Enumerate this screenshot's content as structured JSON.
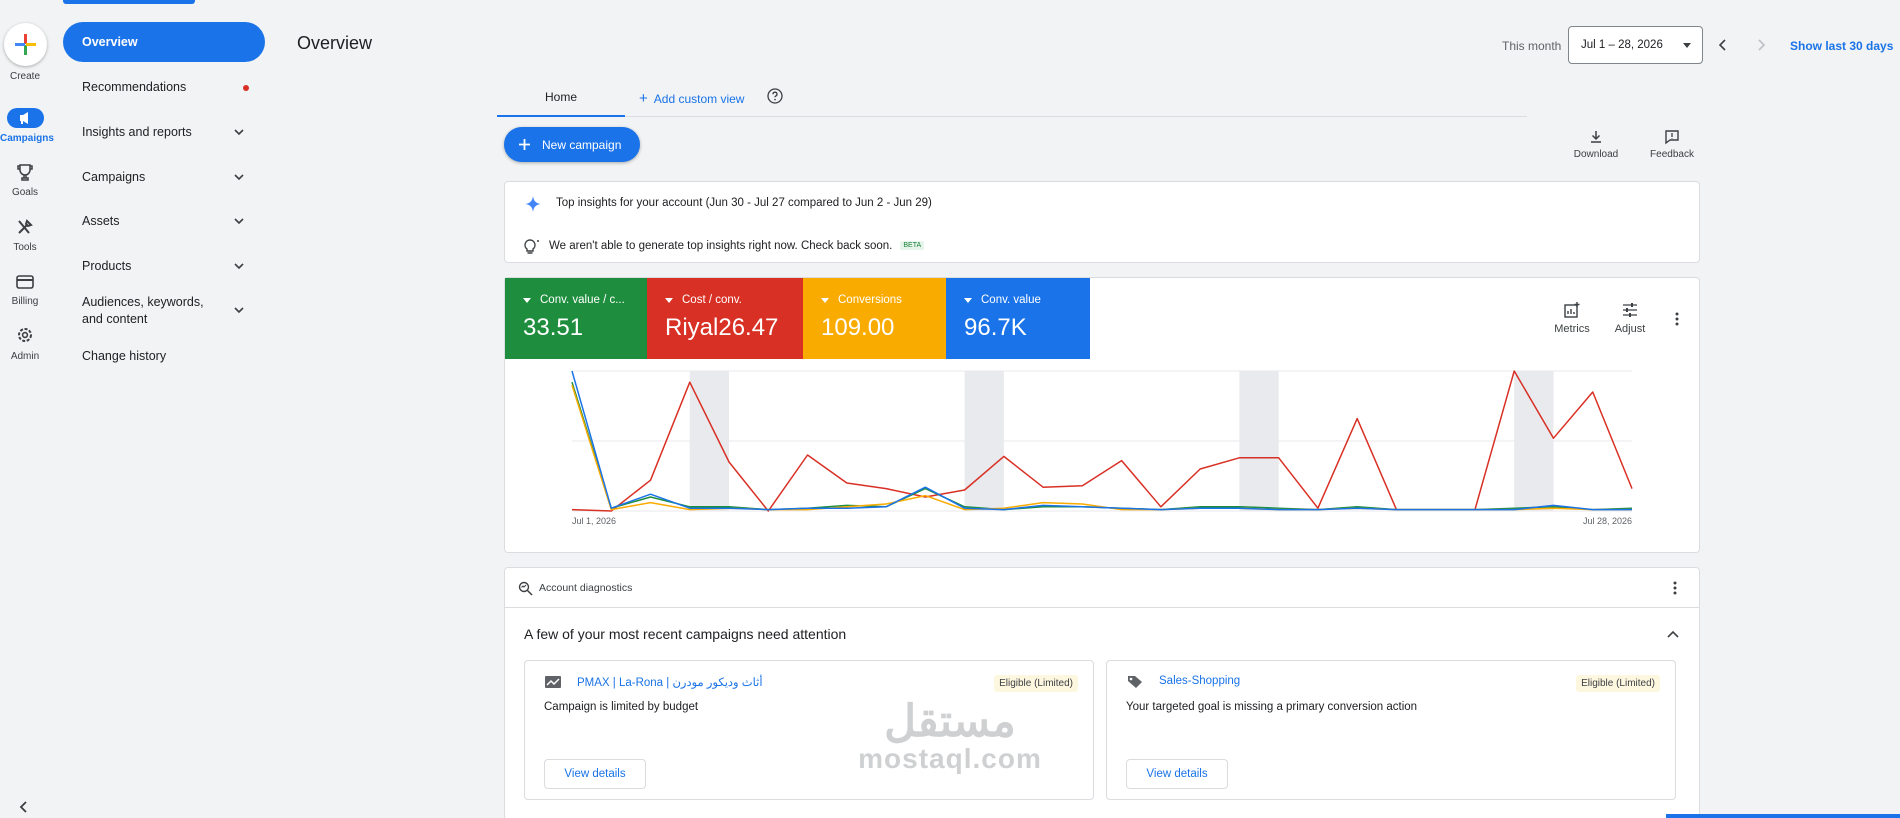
{
  "rail": {
    "create_label": "Create",
    "items": [
      {
        "label": "Campaigns",
        "icon": "megaphone-icon",
        "active": true
      },
      {
        "label": "Goals",
        "icon": "trophy-icon"
      },
      {
        "label": "Tools",
        "icon": "tools-icon"
      },
      {
        "label": "Billing",
        "icon": "credit-card-icon"
      },
      {
        "label": "Admin",
        "icon": "gear-icon"
      }
    ]
  },
  "sidenav": {
    "items": [
      {
        "label": "Overview",
        "active": true
      },
      {
        "label": "Recommendations",
        "dot": true
      },
      {
        "label": "Insights and reports",
        "expandable": true
      },
      {
        "label": "Campaigns",
        "expandable": true
      },
      {
        "label": "Assets",
        "expandable": true
      },
      {
        "label": "Products",
        "expandable": true
      },
      {
        "label": "Audiences, keywords, and content",
        "expandable": true
      },
      {
        "label": "Change history"
      }
    ]
  },
  "header": {
    "title": "Overview",
    "range_label": "This month",
    "date_value": "Jul 1 – 28, 2026",
    "show_last": "Show last 30 days"
  },
  "tabs": {
    "home": "Home",
    "add_custom": "Add custom view"
  },
  "toolbar": {
    "new_campaign": "New campaign",
    "download": "Download",
    "feedback": "Feedback"
  },
  "insights": {
    "heading": "Top insights for your account (Jun 30 - Jul 27 compared to Jun 2 - Jun 29)",
    "message": "We aren't able to generate top insights right now. Check back soon.",
    "badge": "BETA"
  },
  "metrics": [
    {
      "label": "Conv. value / c...",
      "value": "33.51",
      "color": "#1e8e3e"
    },
    {
      "label": "Cost / conv.",
      "value": "Riyal26.47",
      "color": "#d93025"
    },
    {
      "label": "Conversions",
      "value": "109.00",
      "color": "#f9ab00"
    },
    {
      "label": "Conv. value",
      "value": "96.7K",
      "color": "#1a73e8"
    }
  ],
  "chart_actions": {
    "metrics": "Metrics",
    "adjust": "Adjust"
  },
  "chart_data": {
    "type": "line",
    "x_start": "Jul 1, 2026",
    "x_end": "Jul 28, 2026",
    "x": [
      1,
      2,
      3,
      4,
      5,
      6,
      7,
      8,
      9,
      10,
      11,
      12,
      13,
      14,
      15,
      16,
      17,
      18,
      19,
      20,
      21,
      22,
      23,
      24,
      25,
      26,
      27,
      28
    ],
    "weekend_bands": [
      [
        4,
        5
      ],
      [
        11,
        12
      ],
      [
        18,
        19
      ],
      [
        25,
        26
      ]
    ],
    "grid": true,
    "y_scale": "normalized",
    "series": [
      {
        "name": "Cost / conv.",
        "color": "#d93025",
        "values": [
          1,
          0,
          22,
          92,
          35,
          0,
          40,
          20,
          16,
          10,
          15,
          39,
          17,
          18,
          36,
          3,
          30,
          38,
          38,
          2,
          66,
          1,
          1,
          1,
          100,
          52,
          85,
          16
        ]
      },
      {
        "name": "Conv. value / c...",
        "color": "#1e8e3e",
        "values": [
          92,
          2,
          10,
          3,
          3,
          1,
          2,
          4,
          3,
          16,
          3,
          1,
          3,
          3,
          2,
          1,
          3,
          3,
          2,
          1,
          3,
          1,
          1,
          1,
          2,
          3,
          1,
          2
        ]
      },
      {
        "name": "Conversions",
        "color": "#f9ab00",
        "values": [
          90,
          1,
          6,
          1,
          2,
          1,
          1,
          3,
          5,
          11,
          1,
          2,
          6,
          5,
          1,
          1,
          2,
          2,
          1,
          1,
          2,
          1,
          1,
          1,
          1,
          2,
          1,
          1
        ]
      },
      {
        "name": "Conv. value",
        "color": "#1a73e8",
        "values": [
          100,
          2,
          12,
          2,
          2,
          1,
          2,
          2,
          3,
          17,
          2,
          1,
          4,
          3,
          2,
          1,
          2,
          2,
          1,
          1,
          2,
          1,
          1,
          1,
          1,
          4,
          1,
          1
        ]
      }
    ]
  },
  "diagnostics": {
    "title": "Account diagnostics",
    "attention": "A few of your most recent campaigns need attention",
    "campaigns": [
      {
        "name": "PMAX | La-Rona | أثاث وديكور مودرن",
        "badge": "Eligible (Limited)",
        "message": "Campaign is limited by budget",
        "button": "View details"
      },
      {
        "name": "Sales-Shopping",
        "badge": "Eligible (Limited)",
        "message": "Your targeted goal is missing a primary conversion action",
        "button": "View details"
      }
    ]
  },
  "watermark": {
    "line1": "مستقل",
    "line2": "mostaql.com"
  }
}
